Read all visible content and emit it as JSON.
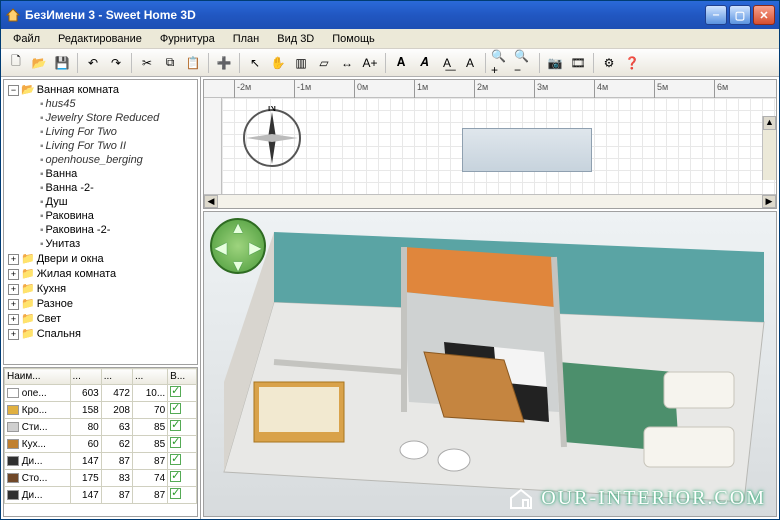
{
  "window": {
    "title": "БезИмени 3 - Sweet Home 3D"
  },
  "menu": {
    "items": [
      "Файл",
      "Редактирование",
      "Фурнитура",
      "План",
      "Вид 3D",
      "Помощь"
    ]
  },
  "toolbar_icons": [
    "new-file-icon",
    "open-icon",
    "save-icon",
    "sep",
    "undo-icon",
    "redo-icon",
    "sep",
    "cut-icon",
    "copy-icon",
    "paste-icon",
    "sep",
    "import-furniture-icon",
    "sep",
    "select-icon",
    "pan-icon",
    "wall-icon",
    "room-icon",
    "dimension-icon",
    "text-icon",
    "sep",
    "bold-icon",
    "italic-icon",
    "font-increase-icon",
    "font-decrease-icon",
    "sep",
    "zoom-in-icon",
    "zoom-out-icon",
    "sep",
    "photo-icon",
    "video-icon",
    "sep",
    "preferences-icon",
    "help-icon"
  ],
  "tree": {
    "root_expanded": {
      "label": "Ванная комната",
      "children": [
        {
          "label": "hus45",
          "kind": "leaf"
        },
        {
          "label": "Jewelry Store Reduced",
          "kind": "leaf"
        },
        {
          "label": "Living For Two",
          "kind": "leaf"
        },
        {
          "label": "Living For Two II",
          "kind": "leaf"
        },
        {
          "label": "openhouse_berging",
          "kind": "leaf"
        },
        {
          "label": "Ванна",
          "kind": "item"
        },
        {
          "label": "Ванна -2-",
          "kind": "item"
        },
        {
          "label": "Душ",
          "kind": "item"
        },
        {
          "label": "Раковина",
          "kind": "item"
        },
        {
          "label": "Раковина -2-",
          "kind": "item"
        },
        {
          "label": "Унитаз",
          "kind": "item"
        }
      ]
    },
    "collapsed": [
      "Двери и окна",
      "Жилая комната",
      "Кухня",
      "Разное",
      "Свет",
      "Спальня"
    ]
  },
  "table": {
    "headers": [
      "Наим...",
      "...",
      "...",
      "...",
      "В..."
    ],
    "rows": [
      {
        "name": "опе...",
        "color": "#ffffff",
        "c1": 603,
        "c2": 472,
        "c3": "10...",
        "visible": true
      },
      {
        "name": "Кро...",
        "color": "#e0b040",
        "c1": 158,
        "c2": 208,
        "c3": 70,
        "visible": true
      },
      {
        "name": "Сти...",
        "color": "#cfcfcf",
        "c1": 80,
        "c2": 63,
        "c3": 85,
        "visible": true
      },
      {
        "name": "Кух...",
        "color": "#c08030",
        "c1": 60,
        "c2": 62,
        "c3": 85,
        "visible": true
      },
      {
        "name": "Ди...",
        "color": "#303030",
        "c1": 147,
        "c2": 87,
        "c3": 87,
        "visible": true
      },
      {
        "name": "Сто...",
        "color": "#704828",
        "c1": 175,
        "c2": 83,
        "c3": 74,
        "visible": true
      },
      {
        "name": "Ди...",
        "color": "#303030",
        "c1": 147,
        "c2": 87,
        "c3": 87,
        "visible": true
      }
    ]
  },
  "plan": {
    "ruler_ticks": [
      {
        "pos": 30,
        "label": "-2м"
      },
      {
        "pos": 90,
        "label": "-1м"
      },
      {
        "pos": 150,
        "label": "0м"
      },
      {
        "pos": 210,
        "label": "1м"
      },
      {
        "pos": 270,
        "label": "2м"
      },
      {
        "pos": 330,
        "label": "3м"
      },
      {
        "pos": 390,
        "label": "4м"
      },
      {
        "pos": 450,
        "label": "5м"
      },
      {
        "pos": 510,
        "label": "6м"
      }
    ],
    "compass_label": "N"
  },
  "watermark": {
    "text": "OUR-INTERIOR.COM"
  }
}
